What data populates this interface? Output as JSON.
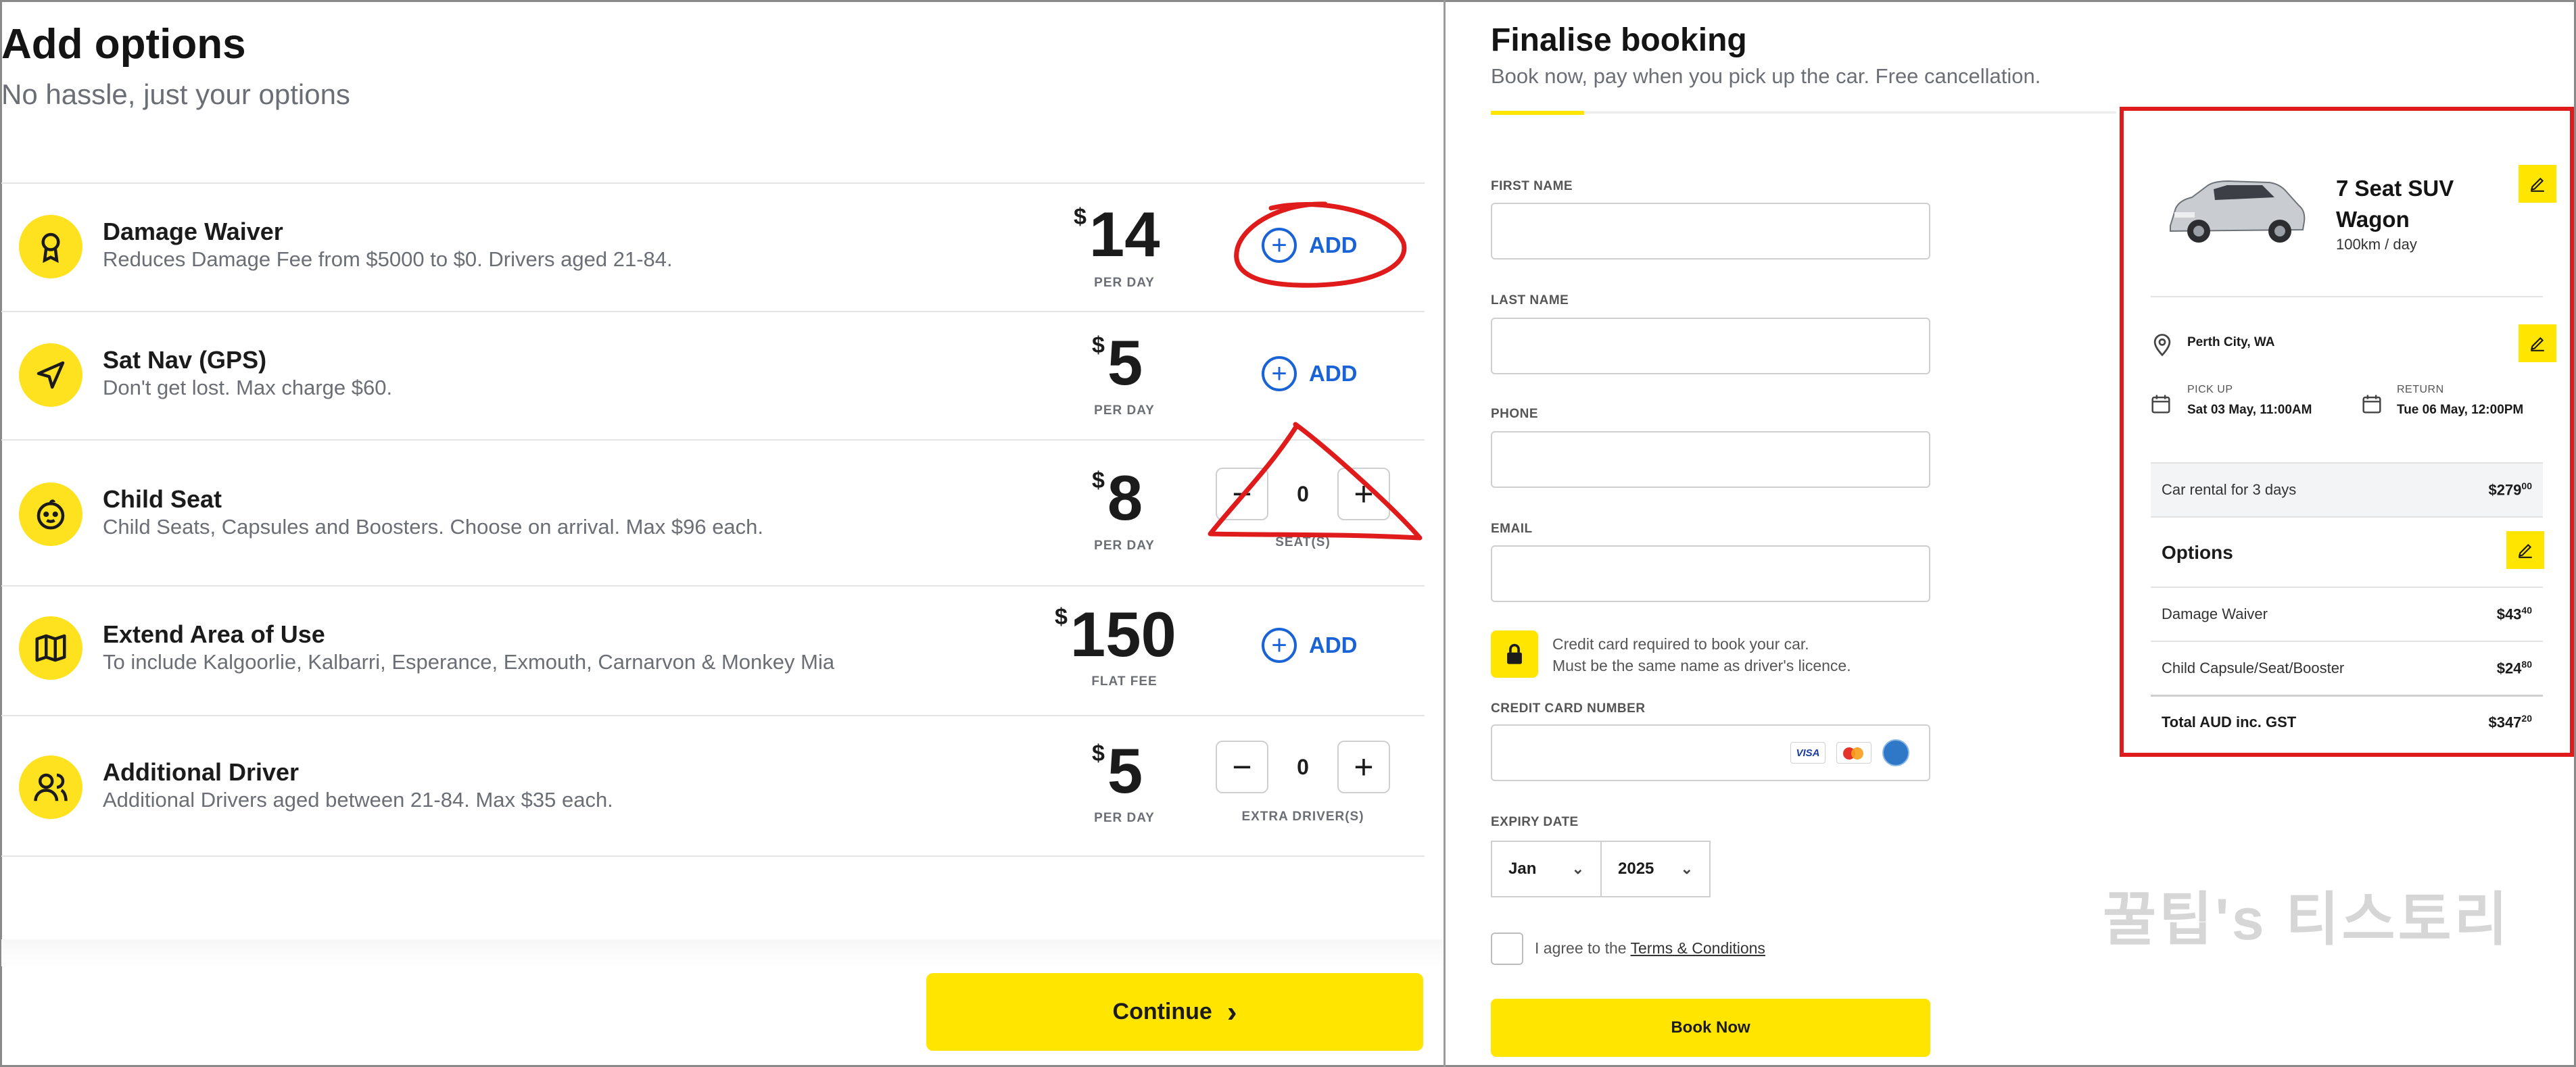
{
  "left": {
    "title": "Add options",
    "subtitle": "No hassle, just your options",
    "options": [
      {
        "name": "Damage Waiver",
        "desc": "Reduces Damage Fee from $5000 to $0. Drivers aged 21-84.",
        "currency": "$",
        "price": "14",
        "per": "PER DAY",
        "action": "ADD",
        "icon": "award-ribbon-icon"
      },
      {
        "name": "Sat Nav (GPS)",
        "desc": "Don't get lost. Max charge $60.",
        "currency": "$",
        "price": "5",
        "per": "PER DAY",
        "action": "ADD",
        "icon": "navigation-arrow-icon"
      },
      {
        "name": "Child Seat",
        "desc": "Child Seats, Capsules and Boosters. Choose on arrival. Max $96 each.",
        "currency": "$",
        "price": "8",
        "per": "PER DAY",
        "minus": "−",
        "count": "0",
        "plus": "+",
        "unit": "SEAT(S)",
        "icon": "baby-face-icon"
      },
      {
        "name": "Extend Area of Use",
        "desc": "To include Kalgoorlie, Kalbarri, Esperance, Exmouth, Carnarvon & Monkey Mia",
        "currency": "$",
        "price": "150",
        "per": "FLAT FEE",
        "action": "ADD",
        "icon": "map-icon"
      },
      {
        "name": "Additional Driver",
        "desc": "Additional Drivers aged between 21-84. Max $35 each.",
        "currency": "$",
        "price": "5",
        "per": "PER DAY",
        "minus": "−",
        "count": "0",
        "plus": "+",
        "unit": "EXTRA DRIVER(S)",
        "icon": "users-icon"
      }
    ],
    "continue_label": "Continue",
    "continue_chevron": "›"
  },
  "right": {
    "title": "Finalise booking",
    "subtitle": "Book now, pay when you pick up the car. Free cancellation.",
    "fields": {
      "first_name": "FIRST NAME",
      "last_name": "LAST NAME",
      "phone": "PHONE",
      "email": "EMAIL",
      "card_number": "CREDIT CARD NUMBER",
      "expiry": "EXPIRY DATE"
    },
    "cc_note_1": "Credit card required to book your car.",
    "cc_note_2": "Must be the same name as driver's licence.",
    "card_logo_visa": "VISA",
    "expiry_month": "Jan",
    "expiry_year": "2025",
    "select_chevron": "⌄",
    "agree_prefix": "I agree to the ",
    "agree_link": "Terms & Conditions",
    "book_now": "Book Now",
    "watermark": "꿀팁's 티스토리"
  },
  "summary": {
    "car_name_1": "7 Seat SUV",
    "car_name_2": "Wagon",
    "car_km": "100km / day",
    "location": "Perth City, WA",
    "pickup_label": "PICK UP",
    "pickup_value": "Sat 03 May, 11:00AM",
    "return_label": "RETURN",
    "return_value": "Tue 06 May, 12:00PM",
    "rental_label": "Car rental for 3 days",
    "rental_amount": "$279",
    "rental_cents": "00",
    "options_heading": "Options",
    "line1_label": "Damage Waiver",
    "line1_amount": "$43",
    "line1_cents": "40",
    "line2_label": "Child Capsule/Seat/Booster",
    "line2_amount": "$24",
    "line2_cents": "80",
    "total_label": "Total AUD inc. GST",
    "total_amount": "$347",
    "total_cents": "20"
  },
  "colors": {
    "accent_yellow": "#ffe500",
    "link_blue": "#1a63d6",
    "annotation_red": "#e01b1b"
  }
}
